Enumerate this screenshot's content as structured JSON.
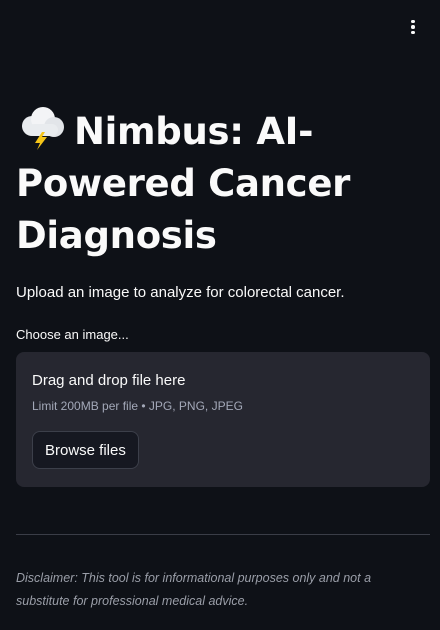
{
  "app": {
    "title_icon": "cloud-lightning-icon",
    "title": "Nimbus: AI-Powered Cancer Diagnosis",
    "subtitle": "Upload an image to analyze for colorectal cancer."
  },
  "toolbar": {
    "menu_icon": "vertical-ellipsis-icon"
  },
  "uploader": {
    "label": "Choose an image...",
    "dropzone_title": "Drag and drop file here",
    "limit_text": "Limit 200MB per file • JPG, PNG, JPEG",
    "browse_label": "Browse files"
  },
  "footer": {
    "disclaimer": "Disclaimer: This tool is for informational purposes only and not a substitute for professional medical advice."
  },
  "colors": {
    "background": "#0e1117",
    "dropzone": "#262730",
    "text": "#fafafa",
    "muted": "#a3a8b8"
  }
}
